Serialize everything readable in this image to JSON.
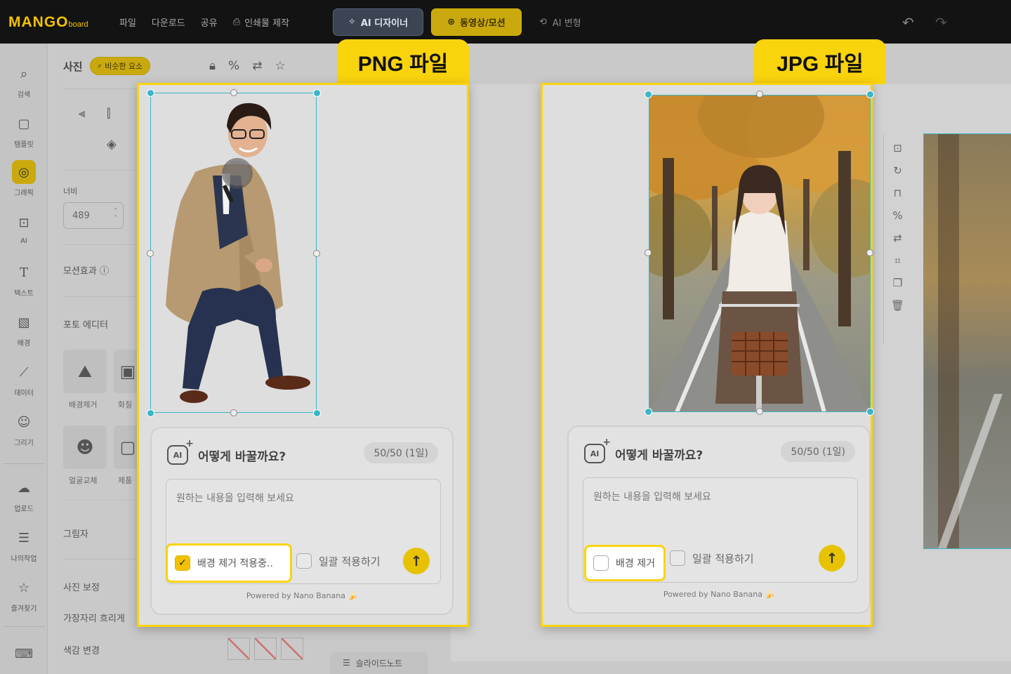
{
  "app": {
    "logo_main": "MANGO",
    "logo_sub": "board"
  },
  "topbar": {
    "menu": [
      "파일",
      "다운로드",
      "공유",
      "인쇄물 제작"
    ],
    "ai_designer": "AI 디자이너",
    "video_motion": "동영상/모션",
    "ai_transform": "AI 변형"
  },
  "rail": {
    "items": [
      "검색",
      "템플릿",
      "그래픽",
      "AI",
      "텍스트",
      "배경",
      "데이터",
      "그리기",
      "업로드",
      "나의작업",
      "즐겨찾기"
    ],
    "active_index": 2
  },
  "panel": {
    "title": "사진",
    "similar_chip": "비슷한 요소",
    "width_label": "너비",
    "width_value": "489",
    "motion_effect": "모션효과",
    "photo_editor": "포토 에디터",
    "tiles": [
      "배경제거",
      "화질",
      "얼굴교체",
      "제품"
    ],
    "shadow": "그림자",
    "photo_correction": "사진 보정",
    "edge_blur": "가장자리 흐리게",
    "color_change": "색감 변경"
  },
  "slide_note": "슬라이드노트",
  "frames": [
    {
      "tab_label": "PNG 파일",
      "ai_card": {
        "question": "어떻게 바꿀까요?",
        "count": "50/50 (1일)",
        "placeholder": "원하는 내용을 입력해 보세요",
        "remove_bg_label": "배경 제거 적용중..",
        "remove_bg_checked": true,
        "bulk_apply": "일괄 적용하기",
        "powered": "Powered by Nano Banana 🍌"
      }
    },
    {
      "tab_label": "JPG 파일",
      "ai_card": {
        "question": "어떻게 바꿀까요?",
        "count": "50/50 (1일)",
        "placeholder": "원하는 내용을 입력해 보세요",
        "remove_bg_label": "배경 제거",
        "remove_bg_checked": false,
        "bulk_apply": "일괄 적용하기",
        "powered": "Powered by Nano Banana 🍌"
      }
    }
  ],
  "colors": {
    "accent_yellow": "#f9d30c",
    "selection_teal": "#3bb6c8",
    "topbar_bg": "#131313"
  }
}
